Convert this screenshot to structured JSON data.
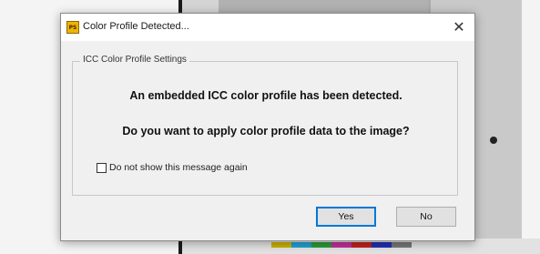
{
  "dialog": {
    "title": "Color Profile Detected...",
    "app_icon_text": "PS",
    "close_glyph": "✕",
    "group_label": "ICC Color Profile Settings",
    "message_line1": "An embedded ICC color profile has been detected.",
    "message_line2": "Do you want to apply color profile data to the image?",
    "checkbox_label": "Do not show this message again",
    "checkbox_checked": false,
    "buttons": {
      "yes": "Yes",
      "no": "No"
    }
  },
  "icons": {
    "app": "app-icon",
    "close": "close-icon"
  },
  "colors": {
    "default_button_border": "#0078d7",
    "dialog_bg": "#f0f0f0",
    "titlebar_bg": "#ffffff"
  }
}
